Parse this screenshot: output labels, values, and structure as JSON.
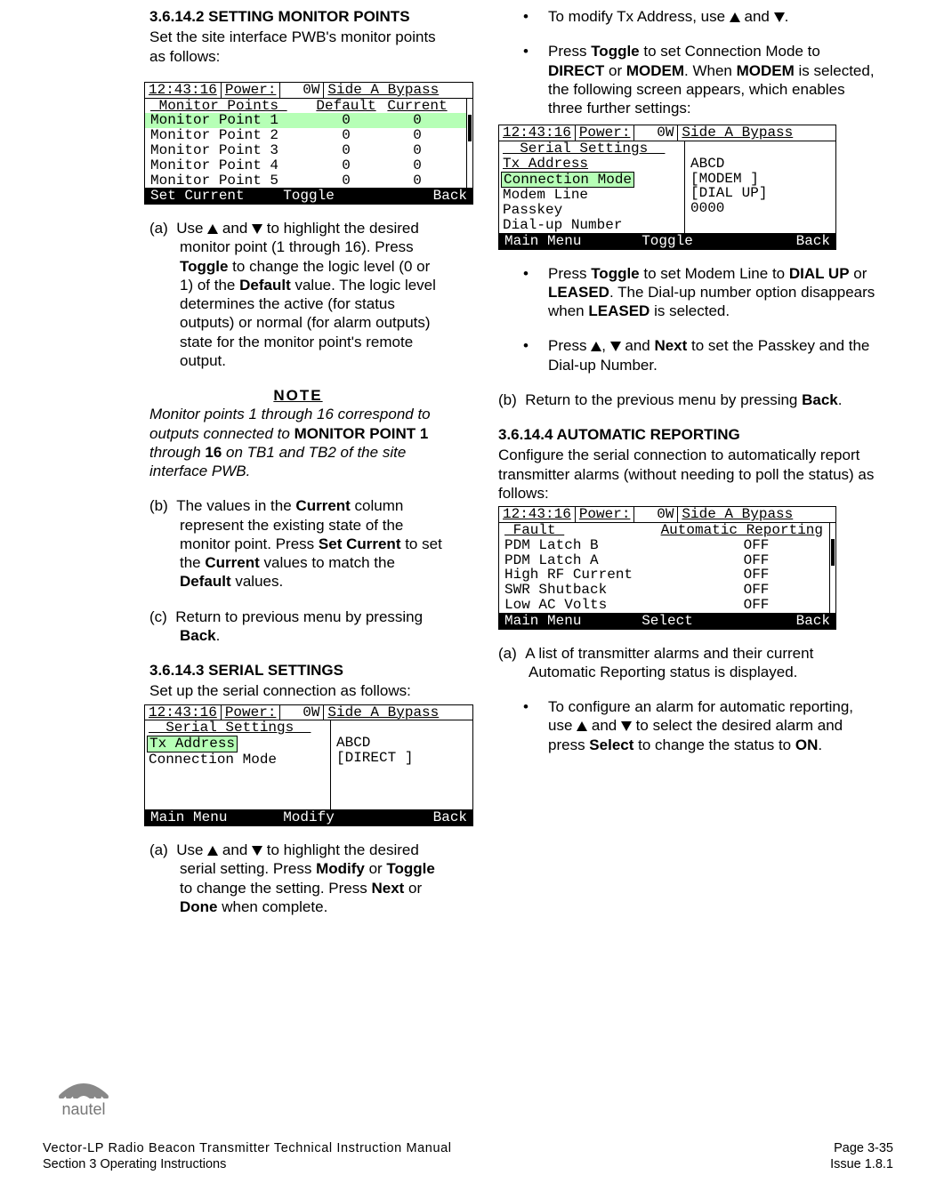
{
  "section_36142": {
    "heading": "3.6.14.2 SETTING MONITOR POINTS",
    "intro": "Set the site interface PWB's monitor points as follows:",
    "step_a": "(a)  Use ▲ and ▼ to highlight the desired monitor point (1 through 16). Press Toggle to change the logic level (0 or 1) of the Default value. The logic level determines the active (for status outputs) or normal (for alarm outputs) state for the monitor point's remote output.",
    "note_hdr": "NOTE",
    "note": "Monitor points 1 through 16 correspond to outputs connected to MONITOR POINT 1 through 16 on TB1 and TB2 of the site interface PWB.",
    "step_b": "(b)  The values in the Current column represent the existing state of the monitor point. Press Set Current to set the Current values to match the Default values.",
    "step_c": "(c)  Return to previous menu by pressing Back."
  },
  "section_36143": {
    "heading": "3.6.14.3 SERIAL SETTINGS",
    "intro": "Set up the serial connection as follows:",
    "step_a": "(a)  Use ▲ and ▼ to highlight the desired serial setting. Press Modify or Toggle to change the setting. Press Next or Done when complete.",
    "bullet_tx": "To modify Tx Address, use ▲ and ▼.",
    "bullet_toggle": "Press Toggle to set Connection Mode to DIRECT or MODEM. When MODEM is selected, the following screen appears, which enables three further settings:",
    "bullet_modem": "Press Toggle to set Modem Line to DIAL UP or LEASED. The Dial-up number option disappears when LEASED is selected.",
    "bullet_passkey": "Press ▲, ▼ and Next to set the Passkey and the Dial-up Number.",
    "step_b": "(b)  Return to the previous menu by pressing Back."
  },
  "section_36144": {
    "heading": "3.6.14.4 AUTOMATIC REPORTING",
    "intro": "Configure the serial connection to automatically report transmitter alarms (without needing to poll the status) as follows:",
    "step_a": "(a)  A list of transmitter alarms and their current Automatic Reporting status is displayed.",
    "bullet_cfg": "To configure an alarm for automatic reporting, use ▲ and ▼ to select the desired alarm and press Select to change the status to ON."
  },
  "lcd_time": "12:43:16",
  "lcd_power_lbl": "Power:",
  "lcd_power_val": "0W",
  "lcd_status": "Side A Bypass",
  "lcd1": {
    "title": " Monitor Points ",
    "hdr_default": "Default",
    "hdr_current": "Current",
    "rows": [
      {
        "n": "Monitor Point 1",
        "d": "0",
        "c": "0"
      },
      {
        "n": "Monitor Point 2",
        "d": "0",
        "c": "0"
      },
      {
        "n": "Monitor Point 3",
        "d": "0",
        "c": "0"
      },
      {
        "n": "Monitor Point 4",
        "d": "0",
        "c": "0"
      },
      {
        "n": "Monitor Point 5",
        "d": "0",
        "c": "0"
      }
    ],
    "f1": "Set Current",
    "f2": "Toggle",
    "f3": "Back"
  },
  "lcd2": {
    "title": "  Serial Settings  ",
    "l1": "Tx Address",
    "l2": "Connection Mode",
    "r1": "ABCD",
    "r2": "[DIRECT ]",
    "f1": "Main Menu",
    "f2": "Modify",
    "f3": "Back"
  },
  "lcd3": {
    "title": "  Serial Settings  ",
    "l1": "Tx Address",
    "l2": "Connection Mode",
    "l3": "Modem Line",
    "l4": "Passkey",
    "l5": "Dial-up Number",
    "r1": "ABCD",
    "r2": "[MODEM ]",
    "r3": "[DIAL UP]",
    "r4": "0000",
    "f1": "Main Menu",
    "f2": "Toggle",
    "f3": "Back"
  },
  "lcd4": {
    "title_l": " Fault ",
    "title_r": "Automatic Reporting",
    "rows": [
      {
        "n": "PDM Latch B",
        "v": "OFF"
      },
      {
        "n": "PDM Latch A",
        "v": "OFF"
      },
      {
        "n": "High RF Current",
        "v": "OFF"
      },
      {
        "n": "SWR Shutback",
        "v": "OFF"
      },
      {
        "n": "Low AC Volts",
        "v": "OFF"
      }
    ],
    "f1": "Main Menu",
    "f2": "Select",
    "f3": "Back"
  },
  "footer": {
    "title": "Vector-LP Radio Beacon Transmitter Technical Instruction Manual",
    "section": "Section 3 Operating Instructions",
    "page": "Page 3-35",
    "issue": "Issue 1.8.1",
    "logo_text": "nautel"
  }
}
